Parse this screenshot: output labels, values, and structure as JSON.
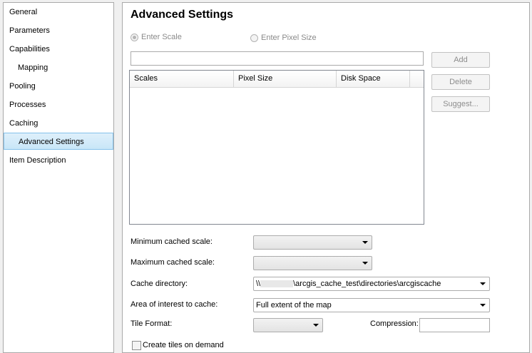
{
  "sidebar": {
    "items": [
      {
        "label": "General"
      },
      {
        "label": "Parameters"
      },
      {
        "label": "Capabilities"
      },
      {
        "label": "Mapping"
      },
      {
        "label": "Pooling"
      },
      {
        "label": "Processes"
      },
      {
        "label": "Caching"
      },
      {
        "label": "Advanced Settings"
      },
      {
        "label": "Item Description"
      }
    ],
    "selected": "Advanced Settings"
  },
  "main": {
    "title": "Advanced Settings",
    "radio_scale": "Enter Scale",
    "radio_pixel": "Enter Pixel Size",
    "scale_input_value": "",
    "buttons": {
      "add": "Add",
      "delete": "Delete",
      "suggest": "Suggest..."
    },
    "grid": {
      "columns": [
        "Scales",
        "Pixel Size",
        "Disk Space"
      ],
      "rows": []
    },
    "fields": {
      "min_scale_label": "Minimum cached scale:",
      "min_scale_value": "",
      "max_scale_label": "Maximum cached scale:",
      "max_scale_value": "",
      "cache_dir_label": "Cache directory:",
      "cache_dir_prefix": "\\\\",
      "cache_dir_value": "\\arcgis_cache_test\\directories\\arcgiscache",
      "aoi_label": "Area of interest to cache:",
      "aoi_value": "Full extent of the map",
      "tile_format_label": "Tile Format:",
      "tile_format_value": "",
      "compression_label": "Compression:",
      "compression_value": "",
      "create_tiles_label": "Create tiles on demand"
    }
  }
}
